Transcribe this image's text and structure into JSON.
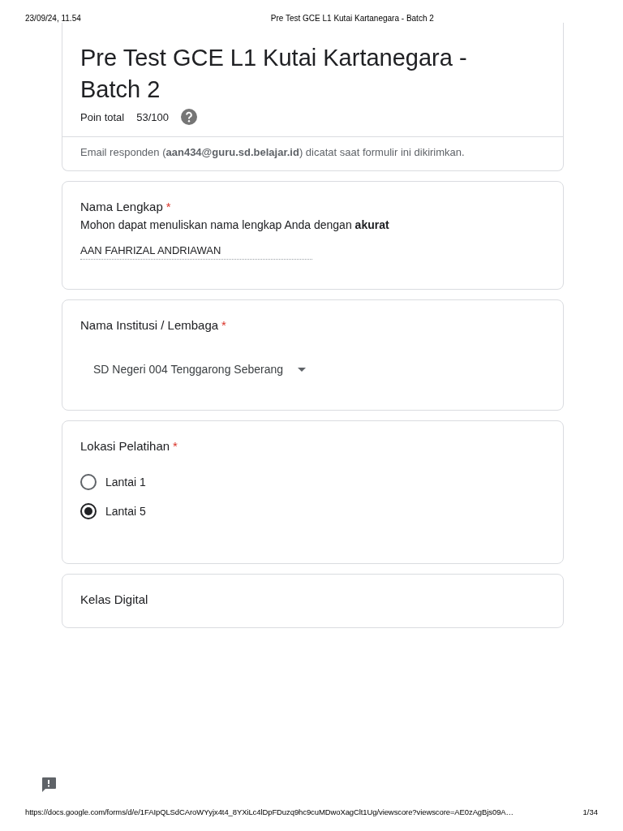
{
  "print_header": {
    "date": "23/09/24, 11.54",
    "title": "Pre Test GCE L1 Kutai Kartanegara - Batch 2"
  },
  "form": {
    "title": "Pre Test GCE L1 Kutai Kartanegara - Batch 2",
    "points_label": "Poin total",
    "points": "53/100",
    "email_note": "Email responden (**aan434@guru.sd.belajar.id**) dicatat saat formulir ini dikirimkan."
  },
  "questions": [
    {
      "kind": "text",
      "title": "Nama Lengkap",
      "required_mark": "*",
      "description": "Mohon dapat menuliskan nama lengkap Anda dengan **akurat**",
      "value": "AAN FAHRIZAL ANDRIAWAN"
    },
    {
      "kind": "dropdown",
      "title": "Nama Institusi / Lembaga",
      "required_mark": "*",
      "value": "SD Negeri 004 Tenggarong Seberang"
    },
    {
      "kind": "radio",
      "title": "Lokasi Pelatihan",
      "required_mark": "*",
      "options": [
        {
          "label": "Lantai 1",
          "selected": false
        },
        {
          "label": "Lantai 5",
          "selected": true
        }
      ]
    },
    {
      "kind": "section",
      "title": "Kelas Digital"
    }
  ],
  "print_footer": {
    "url": "https://docs.google.com/forms/d/e/1FAIpQLSdCAroWYyjx4t4_8YXiLc4lDpFDuzq9hc9cuMDwoXagClt1Ug/viewscore?viewscore=AE0zAgBjs09A…",
    "page": "1/34"
  }
}
